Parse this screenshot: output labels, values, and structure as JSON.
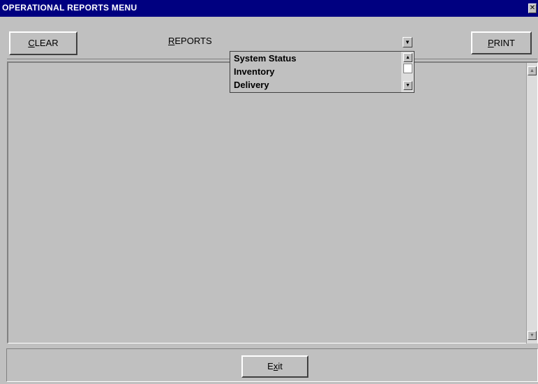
{
  "window": {
    "title": "OPERATIONAL REPORTS MENU",
    "close_glyph": "✕"
  },
  "toolbar": {
    "clear_mnemonic": "C",
    "clear_rest": "LEAR",
    "reports_mnemonic": "R",
    "reports_rest": "EPORTS",
    "print_mnemonic": "P",
    "print_rest": "RINT",
    "dropdown_arrow": "▼"
  },
  "dropdown": {
    "items": [
      "System Status",
      "Inventory",
      "Delivery"
    ],
    "scroll_up": "▲",
    "scroll_down": "▼"
  },
  "content": {
    "scroll_up": "▲",
    "scroll_down": "▼"
  },
  "footer": {
    "exit_before": "E",
    "exit_mnemonic": "x",
    "exit_after": "it"
  }
}
